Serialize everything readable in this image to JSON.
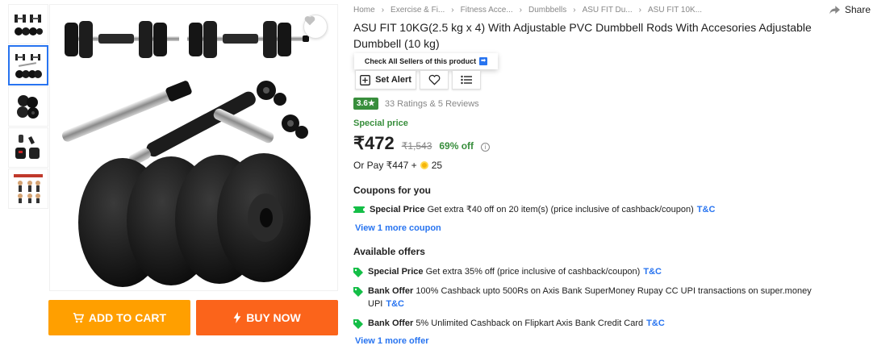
{
  "gallery": {
    "thumbnails": [
      "dumbbell-set",
      "dumbbell-set-active",
      "plates",
      "gloves-grips",
      "exercise-chart"
    ],
    "active_index": 1
  },
  "actions": {
    "add_to_cart": "ADD TO CART",
    "buy_now": "BUY NOW"
  },
  "breadcrumb": [
    "Home",
    "Exercise & Fi...",
    "Fitness Acce...",
    "Dumbbells",
    "ASU FIT Du...",
    "ASU FIT 10K..."
  ],
  "share_label": "Share",
  "product": {
    "title": "ASU FIT 10KG(2.5 kg x 4) With Adjustable PVC Dumbbell Rods With Accesories Adjustable Dumbbell  (10 kg)",
    "check_sellers": "Check All Sellers of this product",
    "set_alert": "Set Alert",
    "rating": "3.6",
    "rating_star": "★",
    "ratings_reviews": "33 Ratings & 5 Reviews",
    "special_price_label": "Special price",
    "price": "₹472",
    "mrp": "₹1,543",
    "discount": "69% off",
    "or_pay_prefix": "Or Pay ₹447 +",
    "or_pay_coins": "25"
  },
  "coupons": {
    "heading": "Coupons for you",
    "items": [
      {
        "title": "Special Price",
        "text": "Get extra ₹40 off on 20 item(s) (price inclusive of cashback/coupon)",
        "tc": "T&C"
      }
    ],
    "more": "View 1 more coupon"
  },
  "offers": {
    "heading": "Available offers",
    "items": [
      {
        "title": "Special Price",
        "text": "Get extra 35% off (price inclusive of cashback/coupon)",
        "tc": "T&C"
      },
      {
        "title": "Bank Offer",
        "text": "100% Cashback upto 500Rs on Axis Bank SuperMoney Rupay CC UPI transactions on super.money UPI",
        "tc": "T&C"
      },
      {
        "title": "Bank Offer",
        "text": "5% Unlimited Cashback on Flipkart Axis Bank Credit Card",
        "tc": "T&C"
      }
    ],
    "more": "View 1 more offer"
  },
  "colors": {
    "brand_blue": "#2874f0",
    "cart_orange": "#ff9f00",
    "buy_orange": "#fb641b",
    "green": "#388e3c",
    "grey_text": "#878787"
  }
}
